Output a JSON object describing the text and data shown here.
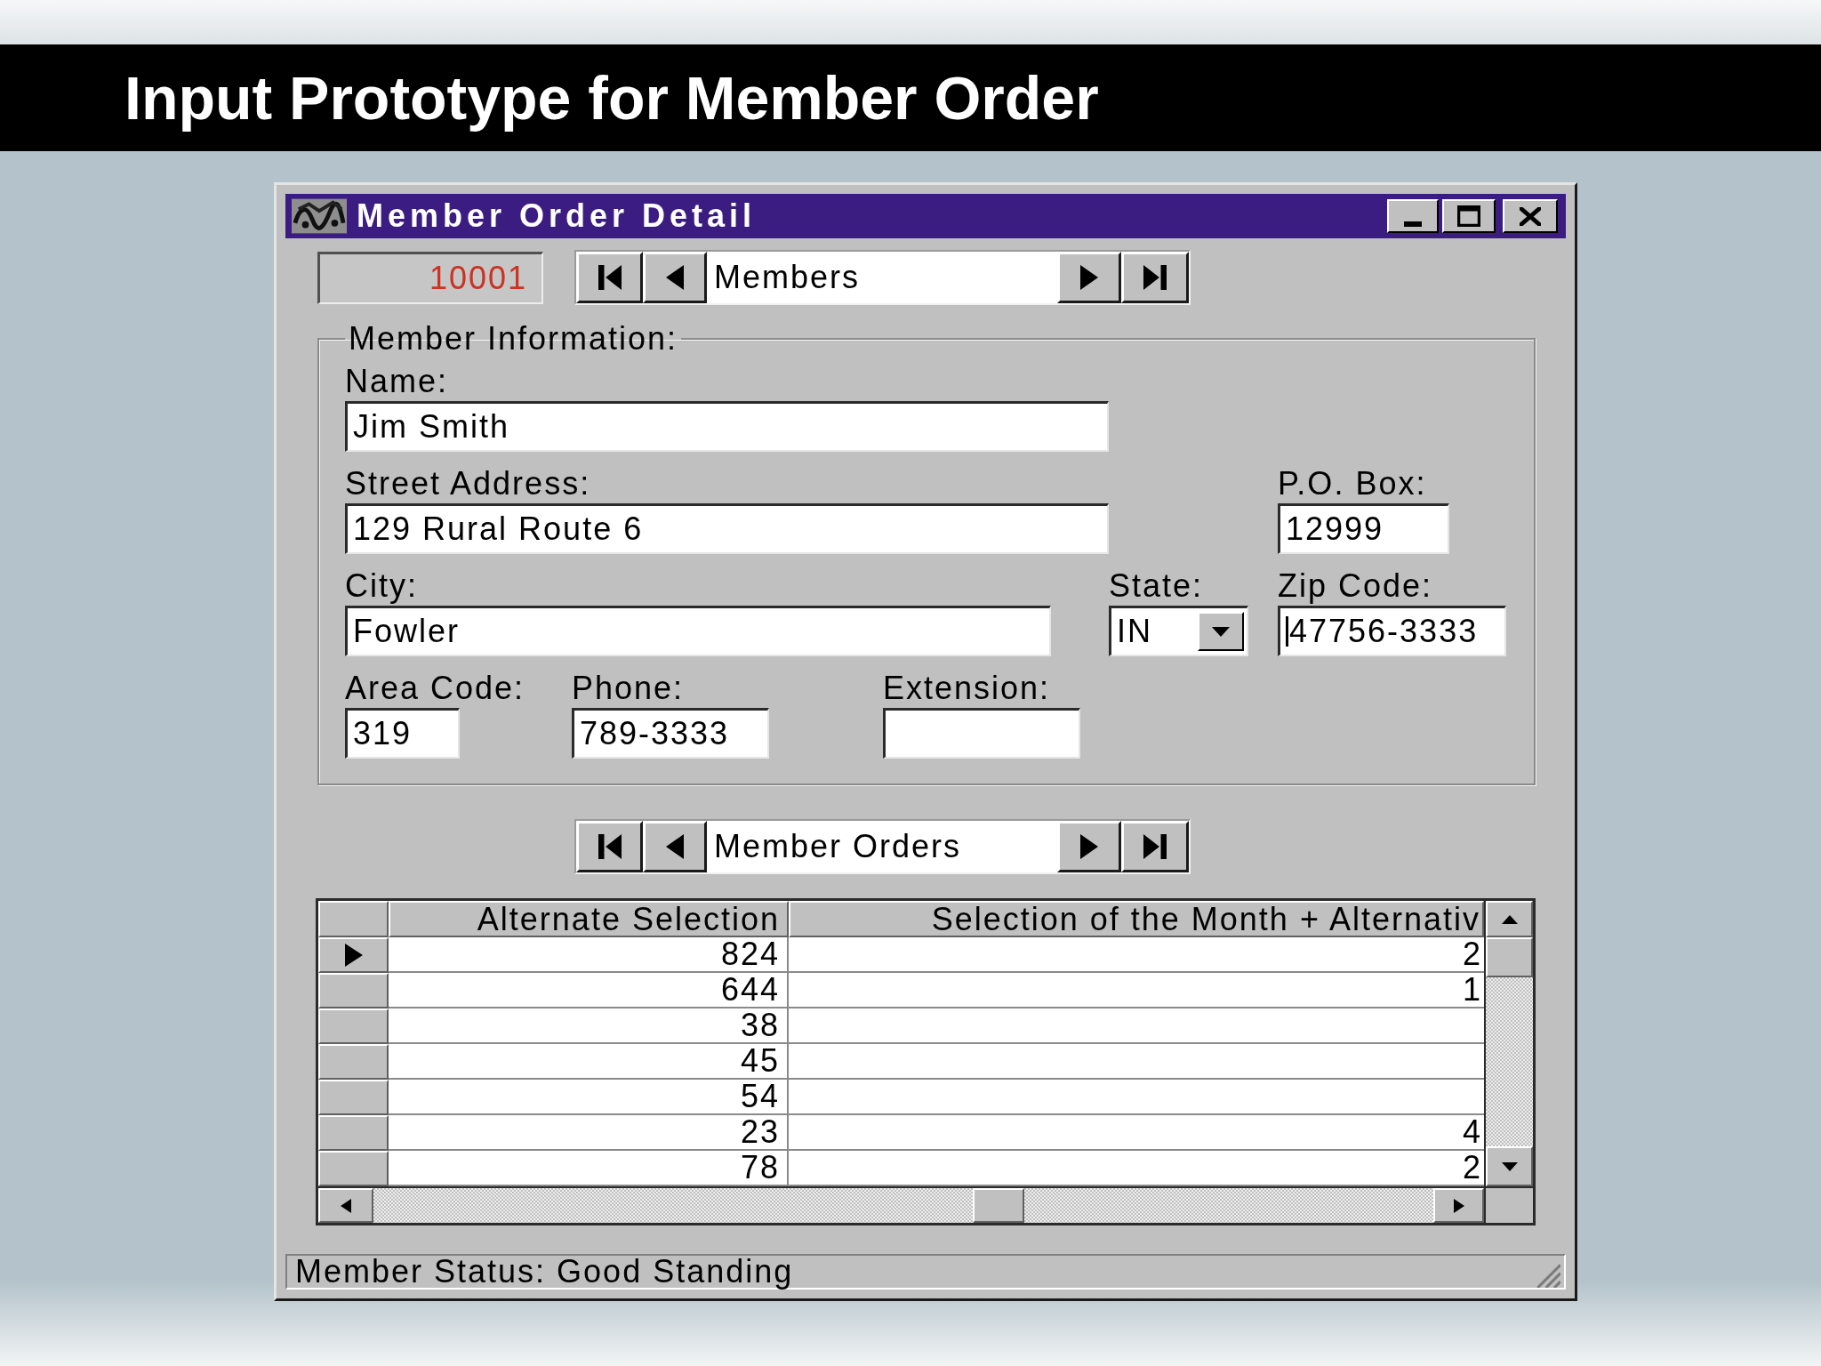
{
  "slide_title": "Input Prototype for Member Order",
  "window": {
    "title": "Member Order Detail"
  },
  "record_number": "10001",
  "members_navigator": {
    "label": "Members"
  },
  "member_information": {
    "legend": "Member Information:",
    "fields": {
      "name": {
        "label": "Name:",
        "kind": "text",
        "value": "Jim Smith",
        "focused": false
      },
      "street_address": {
        "label": "Street Address:",
        "kind": "text",
        "value": "129 Rural Route 6",
        "focused": false
      },
      "po_box": {
        "label": "P.O. Box:",
        "kind": "text",
        "value": "12999",
        "focused": false
      },
      "city": {
        "label": "City:",
        "kind": "text",
        "value": "Fowler",
        "focused": false
      },
      "state": {
        "label": "State:",
        "kind": "dropdown",
        "value": "IN",
        "focused": false
      },
      "zip_code": {
        "label": "Zip Code:",
        "kind": "text",
        "value": "47756-3333",
        "focused": true
      },
      "area_code": {
        "label": "Area Code:",
        "kind": "text",
        "value": "319",
        "focused": false
      },
      "phone": {
        "label": "Phone:",
        "kind": "text",
        "value": "789-3333",
        "focused": false
      },
      "extension": {
        "label": "Extension:",
        "kind": "text",
        "focused": false
      }
    }
  },
  "orders_navigator": {
    "label": "Member Orders"
  },
  "orders_grid": {
    "columns": [
      "Alternate Selection",
      "Selection of the Month + Alternativ"
    ],
    "rows": [
      {
        "selected": true,
        "cells": [
          "824",
          "2"
        ]
      },
      {
        "selected": false,
        "cells": [
          "644",
          "1"
        ]
      },
      {
        "selected": false,
        "cells": [
          "38"
        ]
      },
      {
        "selected": false,
        "cells": [
          "45"
        ]
      },
      {
        "selected": false,
        "cells": [
          "54"
        ]
      },
      {
        "selected": false,
        "cells": [
          "23",
          "4"
        ]
      },
      {
        "selected": false,
        "cells": [
          "78",
          "2"
        ]
      }
    ]
  },
  "status_bar": {
    "text": "Member Status: Good Standing"
  }
}
